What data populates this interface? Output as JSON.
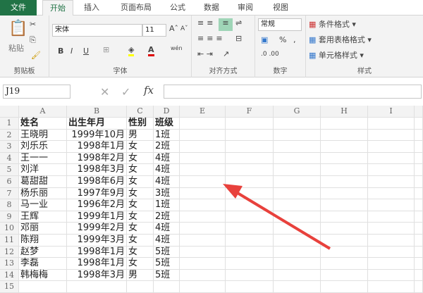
{
  "tabs": [
    "文件",
    "开始",
    "插入",
    "页面布局",
    "公式",
    "数据",
    "审阅",
    "视图"
  ],
  "ribbon": {
    "clipboard": {
      "paste": "粘贴",
      "label": "剪贴板"
    },
    "font": {
      "name": "宋体",
      "size": "11",
      "bold": "B",
      "italic": "I",
      "underline": "U",
      "label": "字体",
      "phonetic": "wén"
    },
    "alignment": {
      "label": "对齐方式"
    },
    "number": {
      "format": "常规",
      "percent": "%",
      "comma": ",",
      "label": "数字"
    },
    "styles": {
      "conditional": "条件格式 ▾",
      "table": "套用表格格式 ▾",
      "cell": "单元格样式 ▾",
      "label": "样式"
    }
  },
  "formula_bar": {
    "name_box": "J19",
    "fx": "fx",
    "value": ""
  },
  "columns": [
    "A",
    "B",
    "C",
    "D",
    "E",
    "F",
    "G",
    "H",
    "I"
  ],
  "rows": [
    [
      "姓名",
      "出生年月",
      "性别",
      "班级"
    ],
    [
      "王晓明",
      "1999年10月",
      "男",
      "1班"
    ],
    [
      "刘乐乐",
      "1998年1月",
      "女",
      "2班"
    ],
    [
      "王一一",
      "1998年2月",
      "女",
      "4班"
    ],
    [
      "刘洋",
      "1998年3月",
      "女",
      "4班"
    ],
    [
      "葛甜甜",
      "1998年6月",
      "女",
      "4班"
    ],
    [
      "杨乐丽",
      "1997年9月",
      "女",
      "3班"
    ],
    [
      "马一业",
      "1996年2月",
      "女",
      "1班"
    ],
    [
      "王辉",
      "1999年1月",
      "女",
      "2班"
    ],
    [
      "邓丽",
      "1999年2月",
      "女",
      "4班"
    ],
    [
      "陈翔",
      "1999年3月",
      "女",
      "4班"
    ],
    [
      "赵梦",
      "1998年1月",
      "女",
      "5班"
    ],
    [
      "李磊",
      "1998年1月",
      "女",
      "5班"
    ],
    [
      "韩梅梅",
      "1998年3月",
      "男",
      "5班"
    ]
  ],
  "colors": {
    "accent": "#217346",
    "arrow": "#e8413c"
  }
}
